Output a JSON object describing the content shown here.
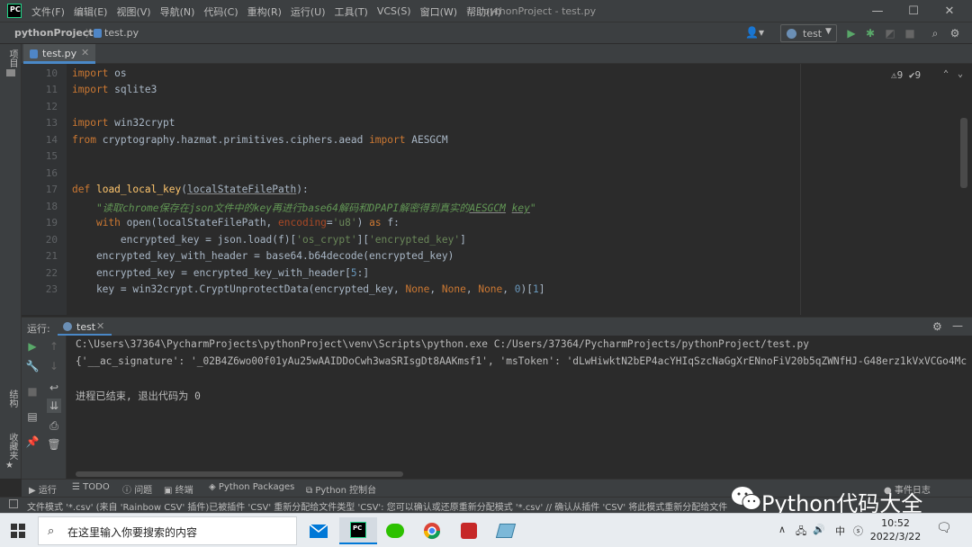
{
  "titlebar": {
    "menu": [
      "文件(F)",
      "编辑(E)",
      "视图(V)",
      "导航(N)",
      "代码(C)",
      "重构(R)",
      "运行(U)",
      "工具(T)",
      "VCS(S)",
      "窗口(W)",
      "帮助(H)"
    ],
    "window_title": "pythonProject - test.py",
    "minimize": "—",
    "maximize": "☐",
    "close": "✕"
  },
  "navbar": {
    "project": "pythonProject",
    "separator": "〉",
    "file": "test.py",
    "run_config": "test"
  },
  "left_stripe": {
    "project": "项目",
    "structure": "结构",
    "favorites": "收藏夹"
  },
  "editor": {
    "tab": "test.py",
    "inspections": "⚠9 ✔9",
    "line_numbers": [
      "10",
      "11",
      "12",
      "13",
      "14",
      "15",
      "16",
      "17",
      "18",
      "19",
      "20",
      "21",
      "22",
      "23"
    ]
  },
  "run": {
    "label": "运行:",
    "tab": "test",
    "console": [
      "C:\\Users\\37364\\PycharmProjects\\pythonProject\\venv\\Scripts\\python.exe C:/Users/37364/PycharmProjects/pythonProject/test.py",
      "{'__ac_signature': '_02B4Z6wo00f01yAu25wAAIDDoCwh3waSRIsgDt8AAKmsf1', 'msToken': 'dLwHiwktN2bEP4acYHIqSzcNaGgXrENnoFiV20b5qZWNfHJ-G48erz1kVxVCGo4Mc",
      "",
      "进程已结束, 退出代码为 0"
    ]
  },
  "bottom_tools": {
    "run": "运行",
    "todo": "TODO",
    "problems": "问题",
    "terminal": "终端",
    "packages": "Python Packages",
    "console": "Python 控制台",
    "event_log": "事件日志"
  },
  "status": "文件模式 '*.csv' (来自 'Rainbow CSV' 插件)已被插件 'CSV' 重新分配给文件类型 'CSV': 您可以确认或还原重新分配模式 '*.csv' // 确认从插件 'CSV' 将此模式重新分配给文件",
  "watermark": "Python代码大全",
  "taskbar": {
    "search_placeholder": "在这里输入你要搜索的内容",
    "time": "10:52",
    "date": "2022/3/22",
    "ime": "中"
  }
}
